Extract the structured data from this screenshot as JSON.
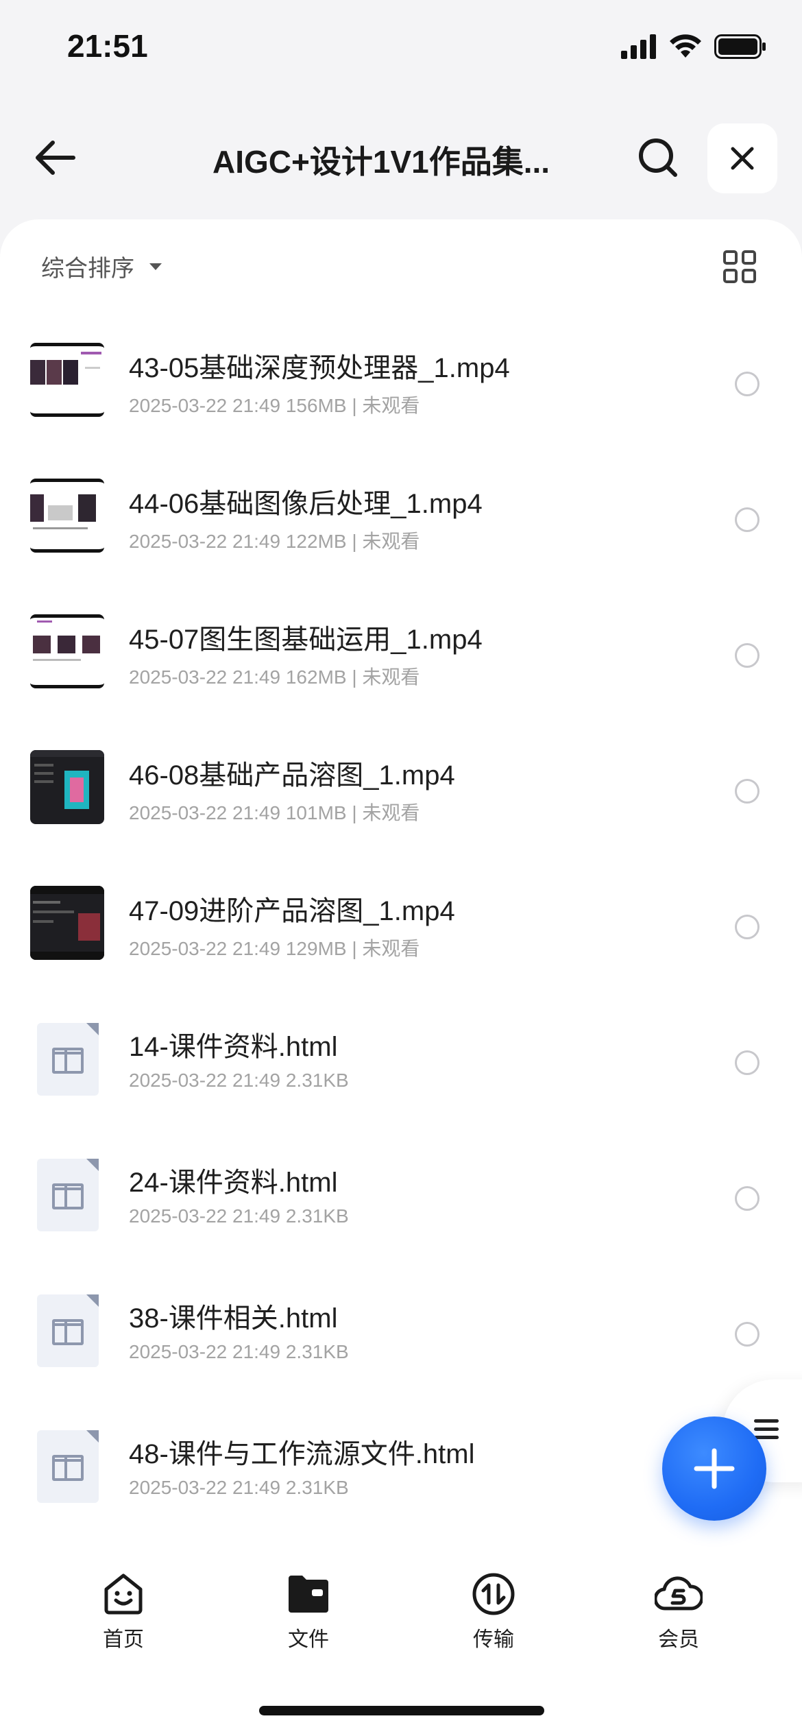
{
  "status": {
    "time": "21:51"
  },
  "header": {
    "title": "AIGC+设计1V1作品集..."
  },
  "toolbar": {
    "sort_label": "综合排序"
  },
  "files": [
    {
      "name": "43-05基础深度预处理器_1.mp4",
      "meta": "2025-03-22 21:49  156MB | 未观看",
      "type": "video"
    },
    {
      "name": "44-06基础图像后处理_1.mp4",
      "meta": "2025-03-22 21:49  122MB | 未观看",
      "type": "video"
    },
    {
      "name": "45-07图生图基础运用_1.mp4",
      "meta": "2025-03-22 21:49  162MB | 未观看",
      "type": "video"
    },
    {
      "name": "46-08基础产品溶图_1.mp4",
      "meta": "2025-03-22 21:49  101MB | 未观看",
      "type": "video"
    },
    {
      "name": "47-09进阶产品溶图_1.mp4",
      "meta": "2025-03-22 21:49  129MB | 未观看",
      "type": "video"
    },
    {
      "name": "14-课件资料.html",
      "meta": "2025-03-22 21:49  2.31KB",
      "type": "html"
    },
    {
      "name": "24-课件资料.html",
      "meta": "2025-03-22 21:49  2.31KB",
      "type": "html"
    },
    {
      "name": "38-课件相关.html",
      "meta": "2025-03-22 21:49  2.31KB",
      "type": "html"
    },
    {
      "name": "48-课件与工作流源文件.html",
      "meta": "2025-03-22 21:49  2.31KB",
      "type": "html"
    }
  ],
  "tabs": [
    {
      "label": "首页",
      "icon": "smiley-home-icon"
    },
    {
      "label": "文件",
      "icon": "folder-icon"
    },
    {
      "label": "传输",
      "icon": "transfer-icon"
    },
    {
      "label": "会员",
      "icon": "vip-cloud-icon"
    }
  ],
  "colors": {
    "accent": "#1f6cf5",
    "background": "#f4f4f6",
    "meta_text": "#a3a3a3"
  }
}
